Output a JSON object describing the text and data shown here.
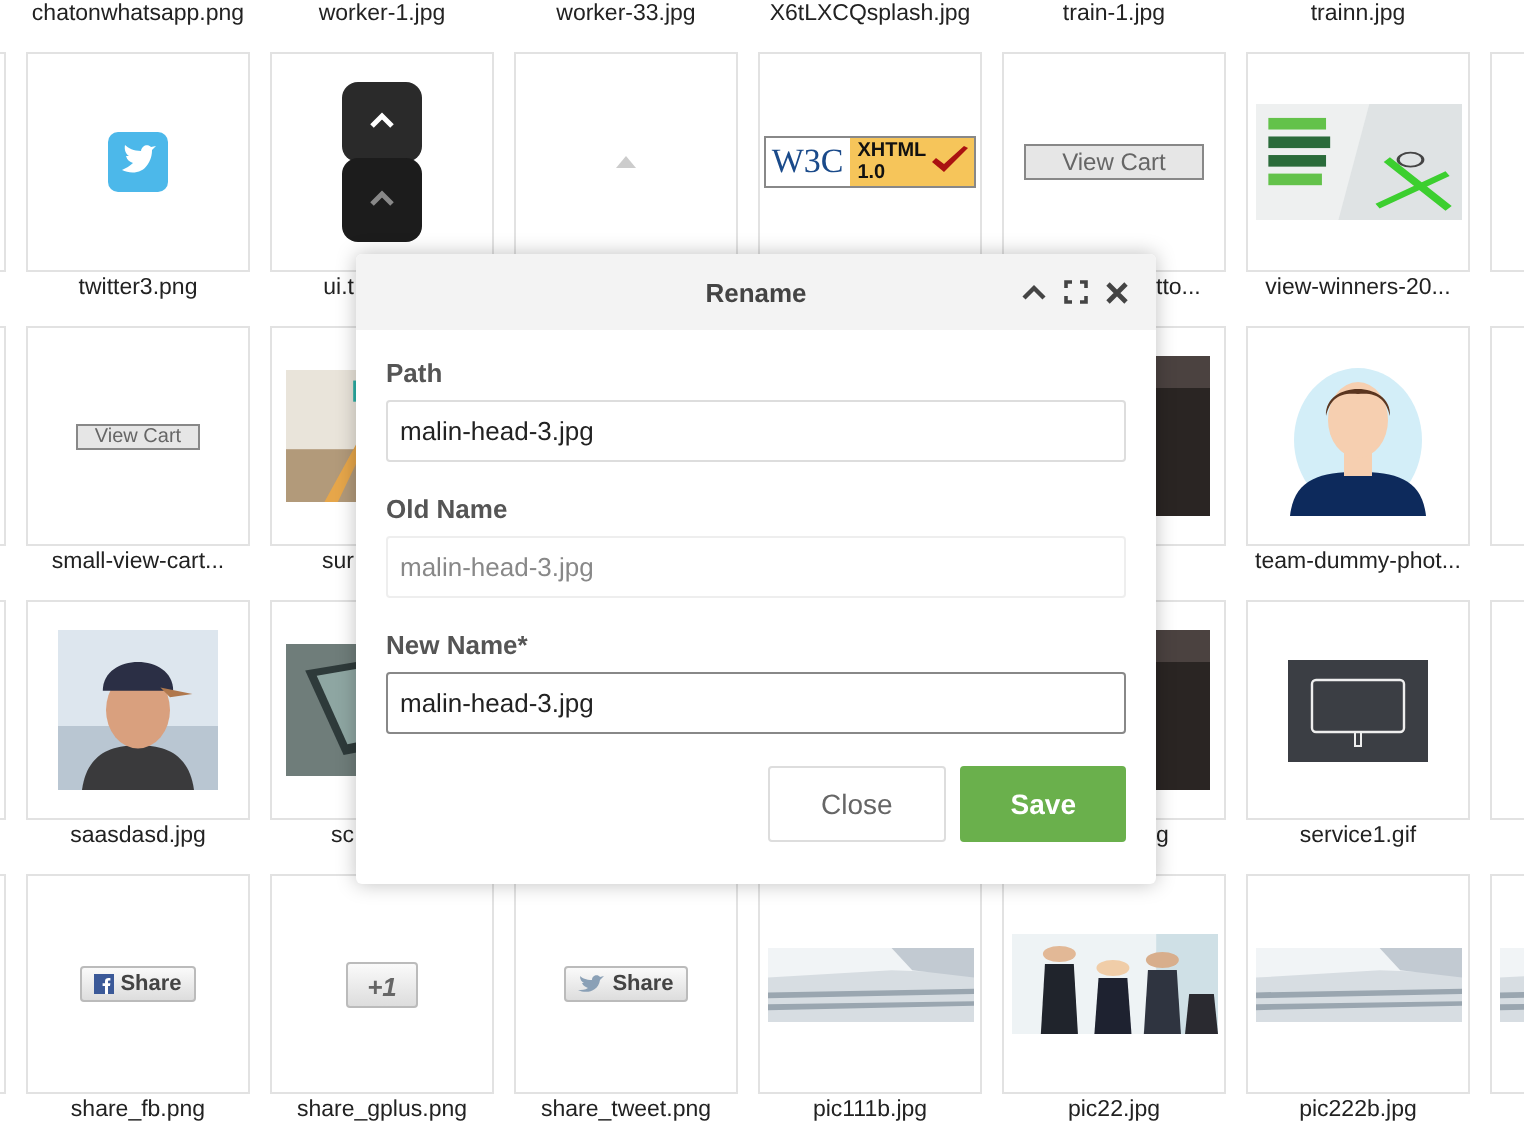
{
  "files": [
    [
      {
        "kind": "blank"
      },
      {
        "kind": "blank",
        "name": "chatonwhatsapp.png"
      },
      {
        "kind": "blank",
        "name": "worker-1.jpg"
      },
      {
        "kind": "blank",
        "name": "worker-33.jpg"
      },
      {
        "kind": "blank",
        "name": "X6tLXCQsplash.jpg"
      },
      {
        "kind": "blank",
        "name": "train-1.jpg"
      },
      {
        "kind": "blank",
        "name": "trainn.jpg"
      },
      {
        "kind": "blank"
      }
    ],
    [
      {
        "kind": "blank"
      },
      {
        "kind": "bird-tile",
        "name": "twitter3.png"
      },
      {
        "kind": "keys",
        "name": "ui.t"
      },
      {
        "kind": "triangle"
      },
      {
        "kind": "badge",
        "texts": [
          "W3C",
          "XHTML",
          "1.0"
        ]
      },
      {
        "kind": "cart-button",
        "text": "View Cart",
        "name": "tto..."
      },
      {
        "kind": "picture",
        "name": "view-winners-20..."
      },
      {
        "kind": "cart-button"
      }
    ],
    [
      {
        "kind": "blank"
      },
      {
        "kind": "cart-button-small",
        "text": "View Cart",
        "name": "small-view-cart..."
      },
      {
        "kind": "picture",
        "name": "sur"
      },
      {
        "kind": "blank"
      },
      {
        "kind": "blank"
      },
      {
        "kind": "picture"
      },
      {
        "kind": "avatar",
        "name": "team-dummy-phot..."
      },
      {
        "kind": "blank"
      }
    ],
    [
      {
        "kind": "blank"
      },
      {
        "kind": "picture",
        "name": "saasdasd.jpg"
      },
      {
        "kind": "picture",
        "name": "sc"
      },
      {
        "kind": "blank"
      },
      {
        "kind": "blank"
      },
      {
        "kind": "picture",
        "name": "g"
      },
      {
        "kind": "screen",
        "name": "service1.gif"
      },
      {
        "kind": "blank"
      }
    ],
    [
      {
        "kind": "blank"
      },
      {
        "kind": "share-f",
        "text": "Share",
        "name": "share_fb.png"
      },
      {
        "kind": "share-plus",
        "text": "+1",
        "name": "share_gplus.png"
      },
      {
        "kind": "share-bird",
        "text": "Share",
        "name": "share_tweet.png"
      },
      {
        "kind": "picture",
        "name": "pic111b.jpg"
      },
      {
        "kind": "picture",
        "name": "pic22.jpg"
      },
      {
        "kind": "picture",
        "name": "pic222b.jpg"
      },
      {
        "kind": "picture"
      }
    ]
  ],
  "dialog": {
    "title": "Rename",
    "fields": [
      {
        "label": "Path",
        "value": "malin-head-3.jpg",
        "disabled": false,
        "focused": false
      },
      {
        "label": "Old Name",
        "value": "malin-head-3.jpg",
        "disabled": true,
        "focused": false
      },
      {
        "label": "New Name*",
        "value": "malin-head-3.jpg",
        "disabled": false,
        "focused": true
      }
    ],
    "buttons": [
      {
        "label": "Close",
        "kind": "secondary"
      },
      {
        "label": "Save",
        "kind": "primary"
      }
    ]
  }
}
